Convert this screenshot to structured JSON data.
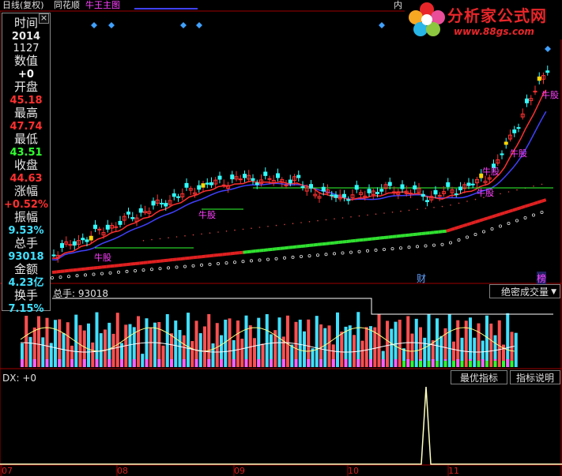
{
  "topbar": {
    "period": "日线(复权)",
    "stock": "同花顺",
    "indicator": "牛王主图",
    "inner": "内"
  },
  "logo": {
    "title": "分析家公式网",
    "url": "www.88gs.com"
  },
  "info_panel": {
    "close_icon": "×",
    "rows": [
      {
        "label": "时间",
        "value": "2014",
        "value2": "1127",
        "color": "#e6e6e6"
      },
      {
        "label": "数值",
        "value": "+0",
        "color": "#ffffff"
      },
      {
        "label": "开盘",
        "value": "45.18",
        "color": "#ff3030"
      },
      {
        "label": "最高",
        "value": "47.74",
        "color": "#ff3030"
      },
      {
        "label": "最低",
        "value": "43.51",
        "color": "#30ff30"
      },
      {
        "label": "收盘",
        "value": "44.63",
        "color": "#ff3030"
      },
      {
        "label": "涨幅",
        "value": "+0.52%",
        "color": "#ff3030"
      },
      {
        "label": "振幅",
        "value": "9.53%",
        "color": "#40e0ff"
      },
      {
        "label": "总手",
        "value": "93018",
        "color": "#40e0ff"
      },
      {
        "label": "金额",
        "value": "4.23亿",
        "color": "#40e0ff"
      },
      {
        "label": "换手",
        "value": "7.15%",
        "color": "#40e0ff"
      }
    ]
  },
  "main_chart": {
    "signal_label": "牛股",
    "markers": {
      "cai": "财",
      "bang": "榜"
    }
  },
  "volume_panel": {
    "label": "总手: 93018",
    "dropdown": "绝密成交量"
  },
  "dx_panel": {
    "label": "DX: +0",
    "btn_best": "最优指标",
    "btn_help": "指标说明"
  },
  "dates": [
    "07",
    "08",
    "09",
    "10",
    "11"
  ],
  "colors": {
    "up": "#ff3030",
    "down": "#30ffff",
    "ma_red": "#ff3030",
    "ma_blue": "#4040ff",
    "ma_green": "#30ff30",
    "signal": "#ff40ff",
    "dx_line": "#ffffc0"
  }
}
